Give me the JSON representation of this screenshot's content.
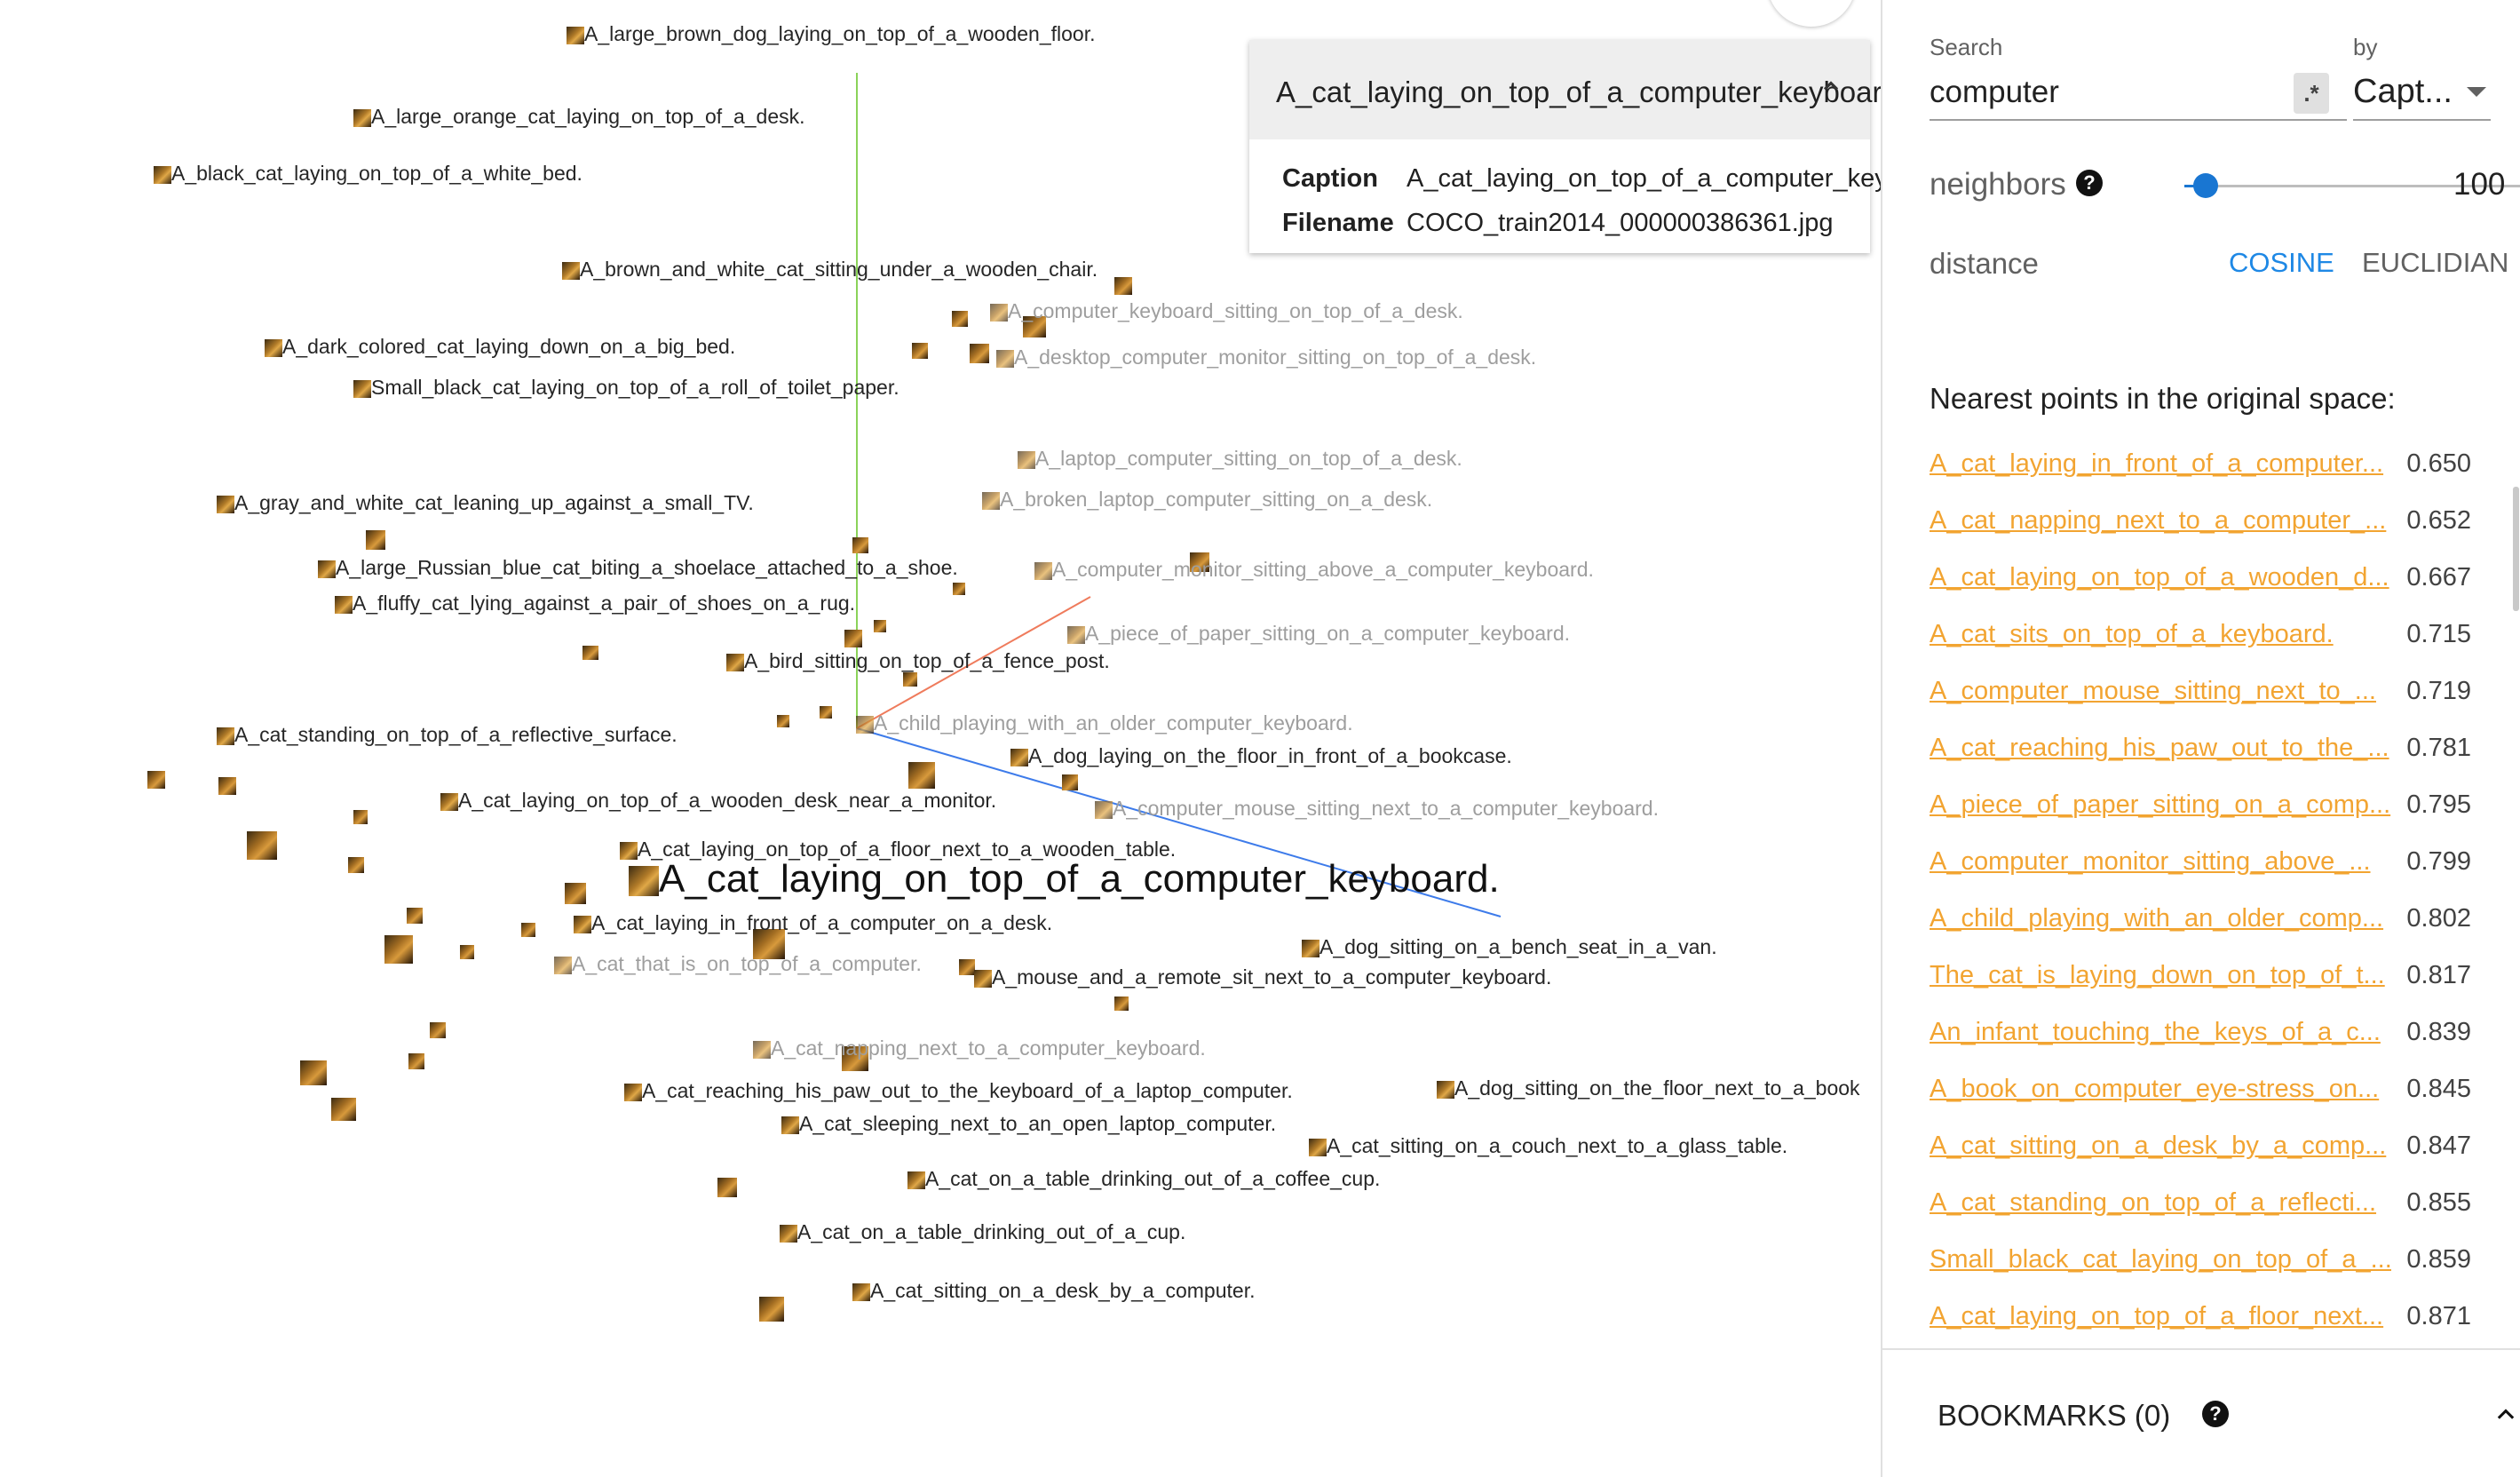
{
  "projector": {
    "main_label": "A_cat_laying_on_top_of_a_computer_keyboard.",
    "labels": [
      {
        "text": "A_large_brown_dog_laying_on_top_of_a_wooden_floor.",
        "faded": false
      },
      {
        "text": "A_large_orange_cat_laying_on_top_of_a_desk.",
        "faded": false
      },
      {
        "text": "A_black_cat_laying_on_top_of_a_white_bed.",
        "faded": false
      },
      {
        "text": "A_brown_and_white_cat_sitting_under_a_wooden_chair.",
        "faded": false
      },
      {
        "text": "A_dark_colored_cat_laying_down_on_a_big_bed.",
        "faded": false
      },
      {
        "text": "Small_black_cat_laying_on_top_of_a_roll_of_toilet_paper.",
        "faded": false
      },
      {
        "text": "A_computer_keyboard_sitting_on_top_of_a_desk.",
        "faded": true
      },
      {
        "text": "A_desktop_computer_monitor_sitting_on_top_of_a_desk.",
        "faded": true
      },
      {
        "text": "A_laptop_computer_sitting_on_top_of_a_desk.",
        "faded": true
      },
      {
        "text": "A_broken_laptop_computer_sitting_on_a_desk.",
        "faded": true
      },
      {
        "text": "A_gray_and_white_cat_leaning_up_against_a_small_TV.",
        "faded": false
      },
      {
        "text": "A_large_Russian_blue_cat_biting_a_shoelace_attached_to_a_shoe.",
        "faded": false
      },
      {
        "text": "A_computer_monitor_sitting_above_a_computer_keyboard.",
        "faded": true
      },
      {
        "text": "A_fluffy_cat_lying_against_a_pair_of_shoes_on_a_rug.",
        "faded": false
      },
      {
        "text": "A_piece_of_paper_sitting_on_a_computer_keyboard.",
        "faded": true
      },
      {
        "text": "A_bird_sitting_on_top_of_a_fence_post.",
        "faded": false
      },
      {
        "text": "A_child_playing_with_an_older_computer_keyboard.",
        "faded": true
      },
      {
        "text": "A_cat_standing_on_top_of_a_reflective_surface.",
        "faded": false
      },
      {
        "text": "A_dog_laying_on_the_floor_in_front_of_a_bookcase.",
        "faded": false
      },
      {
        "text": "A_cat_laying_on_top_of_a_wooden_desk_near_a_monitor.",
        "faded": false
      },
      {
        "text": "A_computer_mouse_sitting_next_to_a_computer_keyboard.",
        "faded": true
      },
      {
        "text": "A_cat_laying_on_top_of_a_floor_next_to_a_wooden_table.",
        "faded": false
      },
      {
        "text": "A_cat_laying_in_front_of_a_computer_on_a_desk.",
        "faded": false
      },
      {
        "text": "A_dog_sitting_on_a_bench_seat_in_a_van.",
        "faded": false
      },
      {
        "text": "A_cat_that_is_on_top_of_a_computer.",
        "faded": true
      },
      {
        "text": "A_mouse_and_a_remote_sit_next_to_a_computer_keyboard.",
        "faded": false
      },
      {
        "text": "A_cat_napping_next_to_a_computer_keyboard.",
        "faded": true
      },
      {
        "text": "A_cat_reaching_his_paw_out_to_the_keyboard_of_a_laptop_computer.",
        "faded": false
      },
      {
        "text": "A_dog_sitting_on_the_floor_next_to_a_book",
        "faded": false
      },
      {
        "text": "A_cat_sleeping_next_to_an_open_laptop_computer.",
        "faded": false
      },
      {
        "text": "A_cat_sitting_on_a_couch_next_to_a_glass_table.",
        "faded": false
      },
      {
        "text": "A_cat_on_a_table_drinking_out_of_a_coffee_cup.",
        "faded": false
      },
      {
        "text": "A_cat_on_a_table_drinking_out_of_a_cup.",
        "faded": false
      },
      {
        "text": "A_cat_sitting_on_a_desk_by_a_computer.",
        "faded": false
      }
    ]
  },
  "inspector": {
    "title": "A_cat_laying_on_top_of_a_computer_keyboard.",
    "caption_key": "Caption",
    "caption_value": "A_cat_laying_on_top_of_a_computer_keyboard.",
    "filename_key": "Filename",
    "filename_value": "COCO_train2014_000000386361.jpg"
  },
  "panel": {
    "search_label": "Search",
    "search_value": "computer",
    "regex_label": ".*",
    "by_label": "by",
    "by_value": "Capt...",
    "neighbors_label": "neighbors",
    "neighbors_value": "100",
    "neighbors_fraction": 0.01,
    "distance_label": "distance",
    "cosine_label": "COSINE",
    "euclidean_label": "EUCLIDIAN",
    "nearest_title": "Nearest points in the original space:",
    "nearest": [
      {
        "caption": "A_cat_laying_in_front_of_a_computer...",
        "value": "0.650"
      },
      {
        "caption": "A_cat_napping_next_to_a_computer_...",
        "value": "0.652"
      },
      {
        "caption": "A_cat_laying_on_top_of_a_wooden_d...",
        "value": "0.667"
      },
      {
        "caption": "A_cat_sits_on_top_of_a_keyboard.",
        "value": "0.715"
      },
      {
        "caption": "A_computer_mouse_sitting_next_to_...",
        "value": "0.719"
      },
      {
        "caption": "A_cat_reaching_his_paw_out_to_the_...",
        "value": "0.781"
      },
      {
        "caption": "A_piece_of_paper_sitting_on_a_comp...",
        "value": "0.795"
      },
      {
        "caption": "A_computer_monitor_sitting_above_...",
        "value": "0.799"
      },
      {
        "caption": "A_child_playing_with_an_older_comp...",
        "value": "0.802"
      },
      {
        "caption": "The_cat_is_laying_down_on_top_of_t...",
        "value": "0.817"
      },
      {
        "caption": "An_infant_touching_the_keys_of_a_c...",
        "value": "0.839"
      },
      {
        "caption": "A_book_on_computer_eye-stress_on...",
        "value": "0.845"
      },
      {
        "caption": "A_cat_sitting_on_a_desk_by_a_comp...",
        "value": "0.847"
      },
      {
        "caption": "A_cat_standing_on_top_of_a_reflecti...",
        "value": "0.855"
      },
      {
        "caption": "Small_black_cat_laying_on_top_of_a_...",
        "value": "0.859"
      },
      {
        "caption": "A_cat_laying_on_top_of_a_floor_next...",
        "value": "0.871"
      }
    ],
    "bookmarks_label": "BOOKMARKS (0)",
    "help_glyph": "?"
  },
  "colors": {
    "accent": "#1e88e5",
    "link": "#f2a431",
    "card_header": "#eeeeee"
  }
}
